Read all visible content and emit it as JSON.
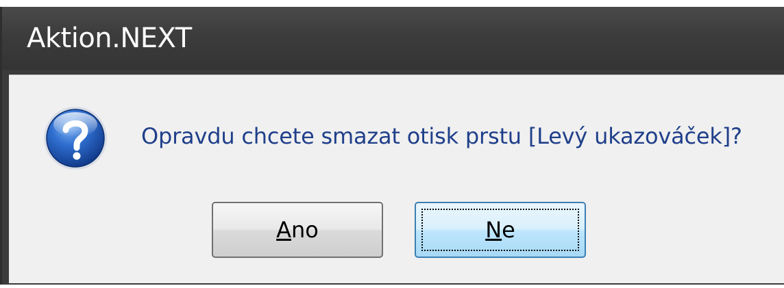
{
  "window": {
    "title": "Aktion.NEXT"
  },
  "dialog": {
    "icon": "question-icon",
    "message": "Opravdu chcete smazat otisk prstu [Levý ukazováček]?",
    "buttons": {
      "yes": {
        "accel": "A",
        "rest": "no"
      },
      "no": {
        "accel": "N",
        "rest": "e"
      }
    },
    "focused_button": "no"
  },
  "colors": {
    "titlebar": "#3c3c3c",
    "client_bg": "#f0f0f0",
    "message_text": "#1f3f8a"
  }
}
